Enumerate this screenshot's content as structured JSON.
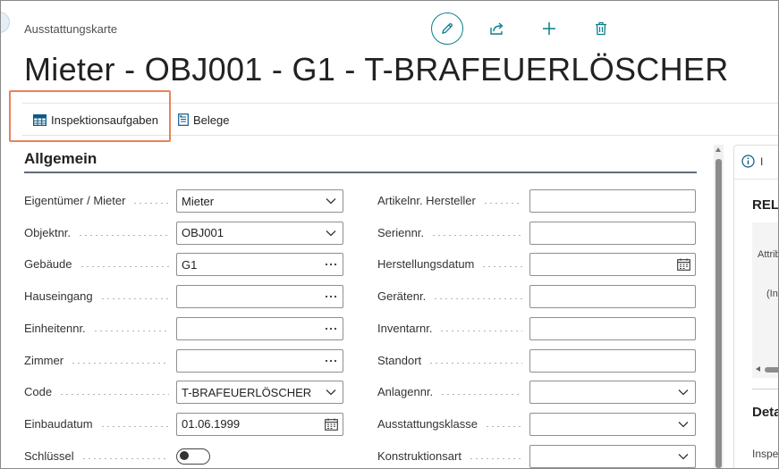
{
  "header": {
    "breadcrumb": "Ausstattungskarte",
    "title": "Mieter - OBJ001 - G1 - T-BRAFEUERLÖSCHER",
    "actions": [
      "edit-icon",
      "share-icon",
      "plus-icon",
      "trash-icon"
    ]
  },
  "toolbar": {
    "inspektionsaufgaben": "Inspektionsaufgaben",
    "belege": "Belege"
  },
  "section": {
    "title": "Allgemein"
  },
  "left_fields": [
    {
      "label": "Eigentümer / Mieter",
      "value": "Mieter",
      "type": "dropdown"
    },
    {
      "label": "Objektnr.",
      "value": "OBJ001",
      "type": "dropdown"
    },
    {
      "label": "Gebäude",
      "value": "G1",
      "type": "lookup"
    },
    {
      "label": "Hauseingang",
      "value": "",
      "type": "lookup"
    },
    {
      "label": "Einheitennr.",
      "value": "",
      "type": "lookup"
    },
    {
      "label": "Zimmer",
      "value": "",
      "type": "lookup"
    },
    {
      "label": "Code",
      "value": "T-BRAFEUERLÖSCHER",
      "type": "dropdown"
    },
    {
      "label": "Einbaudatum",
      "value": "01.06.1999",
      "type": "date"
    },
    {
      "label": "Schlüssel",
      "value": "",
      "type": "toggle"
    }
  ],
  "right_fields": [
    {
      "label": "Artikelnr. Hersteller",
      "value": "",
      "type": "text"
    },
    {
      "label": "Seriennr.",
      "value": "",
      "type": "text"
    },
    {
      "label": "Herstellungsdatum",
      "value": "",
      "type": "date"
    },
    {
      "label": "Gerätenr.",
      "value": "",
      "type": "text"
    },
    {
      "label": "Inventarnr.",
      "value": "",
      "type": "text"
    },
    {
      "label": "Standort",
      "value": "",
      "type": "text"
    },
    {
      "label": "Anlagennr.",
      "value": "",
      "type": "dropdown"
    },
    {
      "label": "Ausstattungsklasse",
      "value": "",
      "type": "dropdown"
    },
    {
      "label": "Konstruktionsart",
      "value": "",
      "type": "dropdown"
    }
  ],
  "side_panel": {
    "tab_letter": "I",
    "title1": "RELi",
    "attr_text": "Attrib",
    "in_text": "(In",
    "title2": "Deta",
    "insp_text": "Inspe"
  },
  "colors": {
    "accent": "#0a7f8c",
    "highlight": "#e8835a"
  }
}
